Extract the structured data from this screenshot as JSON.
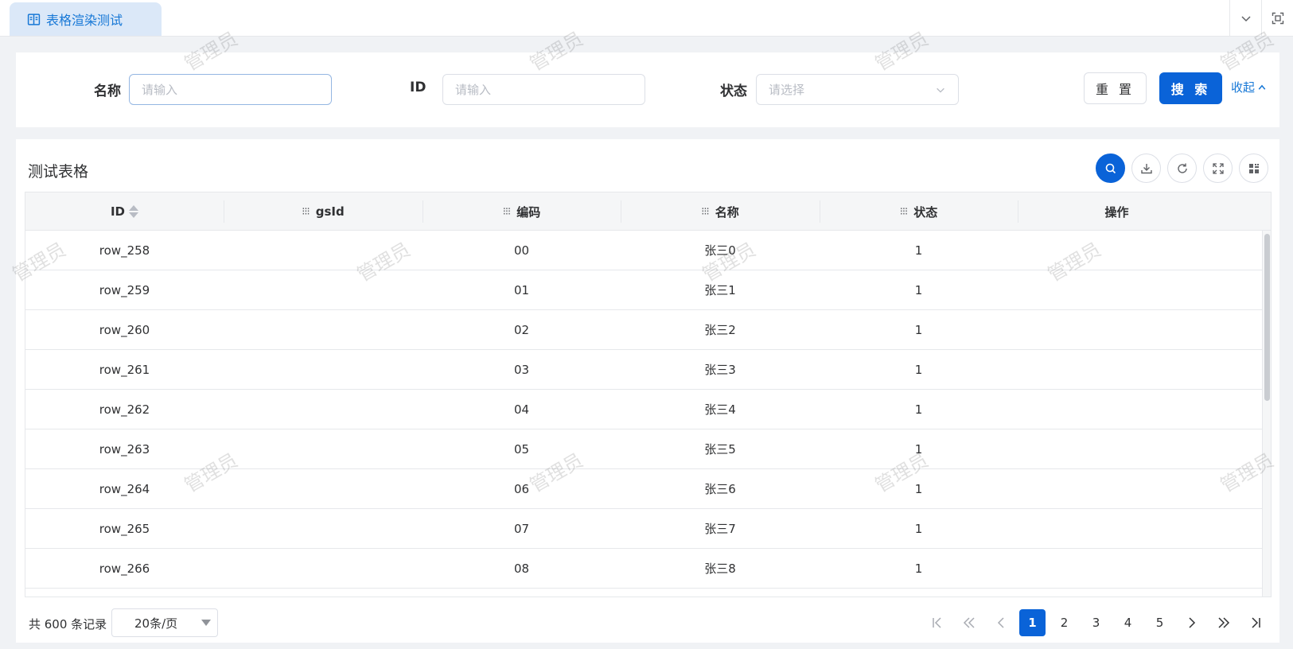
{
  "tab": {
    "title": "表格渲染测试",
    "icon": "book-icon"
  },
  "tabbar_actions": [
    {
      "icon": "chevron-down-icon"
    },
    {
      "icon": "fullscreen-icon"
    }
  ],
  "search": {
    "name_label": "名称",
    "name_placeholder": "请输入",
    "id_label": "ID",
    "id_placeholder": "请输入",
    "status_label": "状态",
    "status_placeholder": "请选择",
    "reset_label": "重 置",
    "search_label": "搜 索",
    "collapse_label": "收起"
  },
  "table": {
    "title": "测试表格",
    "toolbar_icons": [
      "search-icon",
      "download-icon",
      "refresh-icon",
      "fullscreen-icon",
      "column-settings-icon"
    ],
    "columns": [
      "ID",
      "gsId",
      "编码",
      "名称",
      "状态",
      "操作"
    ],
    "rows": [
      {
        "id": "row_258",
        "gsId": "",
        "code": "00",
        "name": "张三0",
        "status": "1",
        "action": ""
      },
      {
        "id": "row_259",
        "gsId": "",
        "code": "01",
        "name": "张三1",
        "status": "1",
        "action": ""
      },
      {
        "id": "row_260",
        "gsId": "",
        "code": "02",
        "name": "张三2",
        "status": "1",
        "action": ""
      },
      {
        "id": "row_261",
        "gsId": "",
        "code": "03",
        "name": "张三3",
        "status": "1",
        "action": ""
      },
      {
        "id": "row_262",
        "gsId": "",
        "code": "04",
        "name": "张三4",
        "status": "1",
        "action": ""
      },
      {
        "id": "row_263",
        "gsId": "",
        "code": "05",
        "name": "张三5",
        "status": "1",
        "action": ""
      },
      {
        "id": "row_264",
        "gsId": "",
        "code": "06",
        "name": "张三6",
        "status": "1",
        "action": ""
      },
      {
        "id": "row_265",
        "gsId": "",
        "code": "07",
        "name": "张三7",
        "status": "1",
        "action": ""
      },
      {
        "id": "row_266",
        "gsId": "",
        "code": "08",
        "name": "张三8",
        "status": "1",
        "action": ""
      }
    ]
  },
  "pagination": {
    "total_text": "共 600 条记录",
    "page_size": "20条/页",
    "pages": [
      "1",
      "2",
      "3",
      "4",
      "5"
    ],
    "current_page": "1"
  },
  "watermark": "管理员",
  "colors": {
    "primary": "#0a63d8",
    "tab_bg": "#dbe8f8",
    "link": "#1677d6",
    "page_bg": "#f0f2f5"
  }
}
